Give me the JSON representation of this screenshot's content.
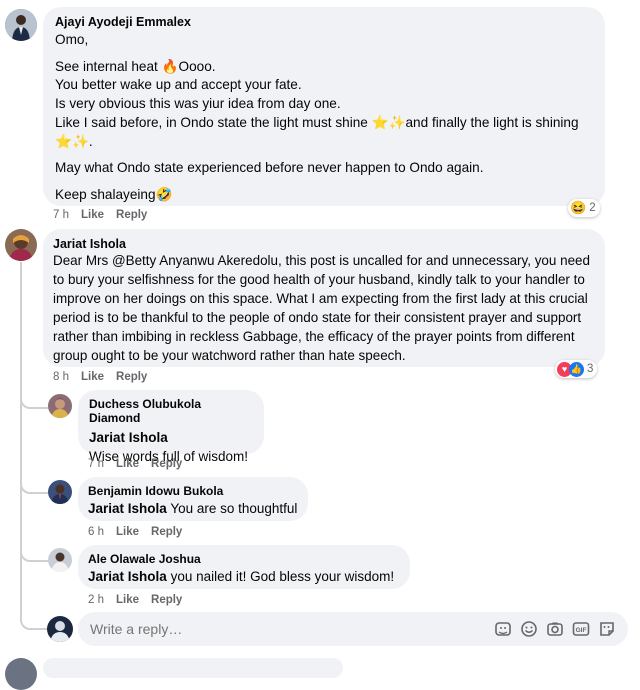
{
  "comments": [
    {
      "author": "Ajayi Ayodeji Emmalex",
      "lines": [
        "Omo,",
        "See internal heat ",
        "Oooo.",
        "You better wake up and accept your fate.",
        "Is very obvious this was yiur idea from day one.",
        "Like I said before, in Ondo state the light must shine ",
        "and finally the light is shining",
        ".",
        "May what Ondo state experienced before never happen to Ondo again.",
        "Keep shalayeing"
      ],
      "time": "7 h",
      "like": "Like",
      "reply": "Reply",
      "reaction_count": "2"
    },
    {
      "author": "Jariat Ishola",
      "text": "Dear Mrs @Betty Anyanwu Akeredolu, this post is uncalled for and unnecessary, you need to bury your selfishness for the good health of your husband, kindly talk to your handler to improve on her doings on this space. What I am expecting from the first lady at this crucial period is to be thankful to the people of ondo state for their consistent prayer and support rather than imbibing in reckless Gabbage, the efficacy of the prayer points from different group ought to be your watchword rather than hate speech.",
      "time": "8 h",
      "like": "Like",
      "reply": "Reply",
      "reaction_count": "3"
    }
  ],
  "replies": [
    {
      "author": "Duchess Olubukola Diamond",
      "mention": "Jariat Ishola",
      "text": "Wise words full of wisdom!",
      "time": "7 h",
      "like": "Like",
      "reply": "Reply"
    },
    {
      "author": "Benjamin Idowu Bukola",
      "mention": "Jariat Ishola",
      "text": "You are so thoughtful",
      "time": "6 h",
      "like": "Like",
      "reply": "Reply"
    },
    {
      "author": "Ale Olawale Joshua",
      "mention": "Jariat Ishola",
      "text": "you nailed it! God bless your wisdom!",
      "time": "2 h",
      "like": "Like",
      "reply": "Reply"
    }
  ],
  "reply_box": {
    "placeholder": "Write a reply…",
    "icons": [
      "sticker-icon",
      "emoji-icon",
      "camera-icon",
      "gif-icon",
      "sticker-face-icon"
    ]
  },
  "colors": {
    "bubble": "#f0f2f5",
    "meta_text": "#65676b",
    "like_blue": "#1877f2",
    "love_red": "#f33e58"
  }
}
